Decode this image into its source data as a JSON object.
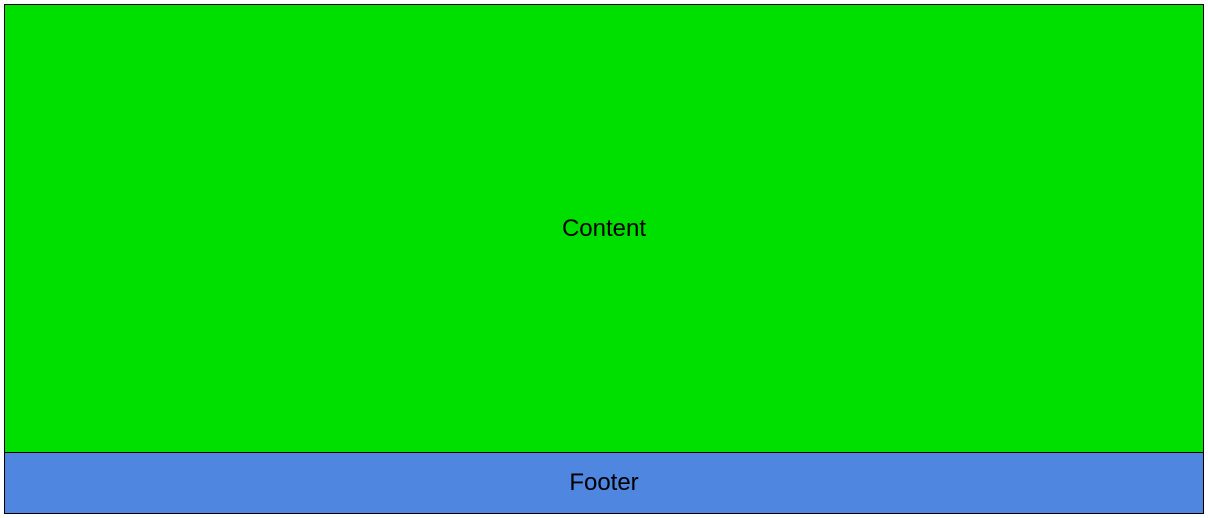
{
  "content": {
    "label": "Content"
  },
  "footer": {
    "label": "Footer"
  },
  "colors": {
    "content_bg": "#00e000",
    "footer_bg": "#4f86e0",
    "border": "#000000"
  }
}
